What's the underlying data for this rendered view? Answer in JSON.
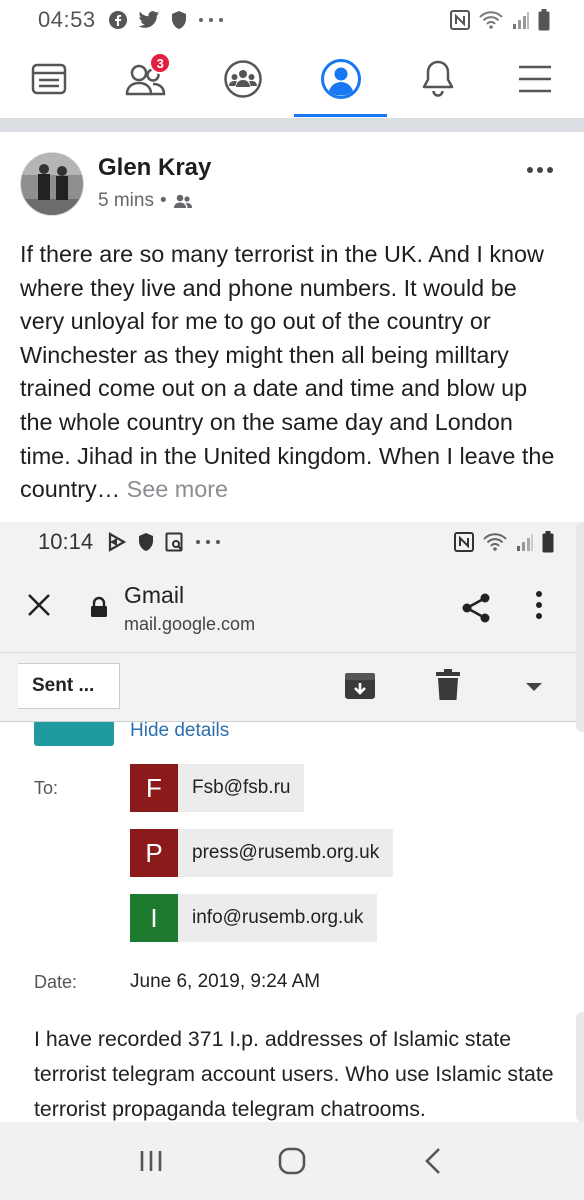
{
  "facebook_status_bar": {
    "time": "04:53",
    "icons": [
      "facebook-icon",
      "twitter-icon",
      "shield-icon",
      "more-dots-icon",
      "nfc-icon",
      "wifi-icon",
      "signal-icon",
      "battery-icon"
    ]
  },
  "facebook_nav": {
    "tabs": [
      {
        "name": "news-feed",
        "icon": "news-feed-icon"
      },
      {
        "name": "friends",
        "icon": "friends-icon",
        "badge": "3"
      },
      {
        "name": "groups",
        "icon": "groups-icon"
      },
      {
        "name": "profile",
        "icon": "profile-icon",
        "active": true
      },
      {
        "name": "notifications",
        "icon": "bell-icon"
      },
      {
        "name": "menu",
        "icon": "hamburger-icon"
      }
    ],
    "accent_color": "#1877f2",
    "badge_color": "#e41e3f"
  },
  "post": {
    "author": "Glen Kray",
    "time": "5 mins",
    "dot": "•",
    "audience_icon": "friends-audience-icon",
    "text": "If there are so many terrorist in the UK. And I know where they live and phone numbers. It would be very unloyal for me to go out of the country or Winchester as they might then all being milltary trained come out on a date and time and blow up the whole country on the same day and London time. Jihad in the United kingdom.  When I leave the country…",
    "see_more": "See more"
  },
  "embedded_screenshot": {
    "status_bar": {
      "time": "10:14",
      "icons": [
        "play-icon",
        "shield-icon",
        "screenshot-icon",
        "more-dots-icon",
        "nfc-icon",
        "wifi-icon",
        "signal-icon",
        "battery-icon"
      ]
    },
    "browser": {
      "title": "Gmail",
      "url": "mail.google.com"
    },
    "toolbar": {
      "back_label": "Sent ..."
    },
    "email": {
      "hide_details": "Hide details",
      "to_label": "To:",
      "recipients": [
        {
          "letter": "F",
          "address": "Fsb@fsb.ru",
          "color": "#8b1a1a"
        },
        {
          "letter": "P",
          "address": "press@rusemb.org.uk",
          "color": "#8b1a1a"
        },
        {
          "letter": "I",
          "address": "info@rusemb.org.uk",
          "color": "#1e7a2e"
        }
      ],
      "date_label": "Date:",
      "date_value": "June 6, 2019, 9:24 AM",
      "body": "I have recorded 371 I.p. addresses of Islamic state terrorist telegram account users.  Who use Islamic state terrorist propaganda telegram chatrooms."
    }
  },
  "android_nav": {
    "buttons": [
      "recents-icon",
      "home-icon",
      "back-icon"
    ]
  }
}
